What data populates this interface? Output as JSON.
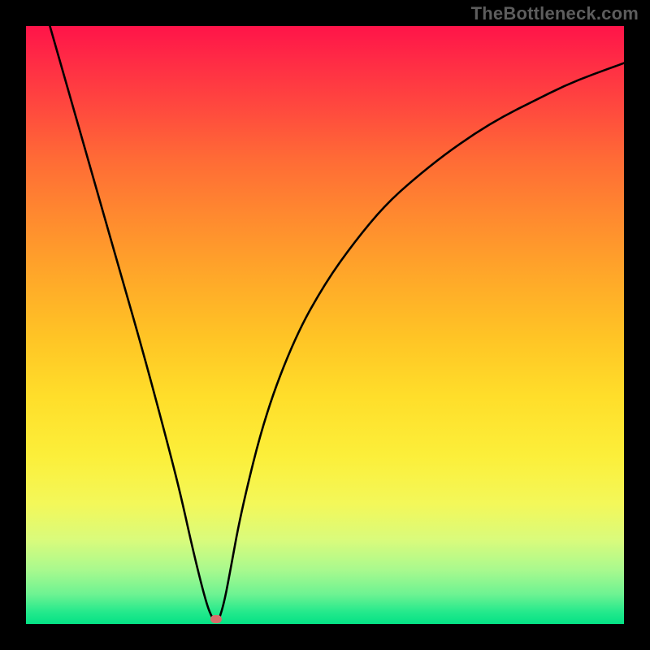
{
  "watermark": "TheBottleneck.com",
  "colors": {
    "frame": "#000000",
    "curve": "#000000",
    "marker": "#d86d6b",
    "watermark_text": "#5d5d5d"
  },
  "chart_data": {
    "type": "line",
    "title": "",
    "xlabel": "",
    "ylabel": "",
    "xlim": [
      0,
      1
    ],
    "ylim": [
      0,
      1
    ],
    "grid": false,
    "legend": false,
    "comment": "Values estimated from pixel positions; x is normalized 0-1 left→right across the 736px plot area, y is normalized 0-1 bottom→top (0 = bottom/green, 1 = top/red).",
    "series": [
      {
        "name": "curve",
        "x": [
          0.04,
          0.08,
          0.12,
          0.16,
          0.2,
          0.24,
          0.26,
          0.28,
          0.3,
          0.31,
          0.32,
          0.33,
          0.34,
          0.36,
          0.4,
          0.45,
          0.5,
          0.55,
          0.6,
          0.65,
          0.7,
          0.75,
          0.8,
          0.85,
          0.9,
          0.95,
          1.0
        ],
        "y": [
          1.0,
          0.86,
          0.72,
          0.58,
          0.44,
          0.29,
          0.21,
          0.12,
          0.04,
          0.012,
          0.0,
          0.03,
          0.08,
          0.19,
          0.35,
          0.48,
          0.57,
          0.64,
          0.7,
          0.745,
          0.785,
          0.82,
          0.85,
          0.875,
          0.9,
          0.92,
          0.938
        ]
      }
    ],
    "marker": {
      "x": 0.318,
      "y": 0.008
    }
  }
}
